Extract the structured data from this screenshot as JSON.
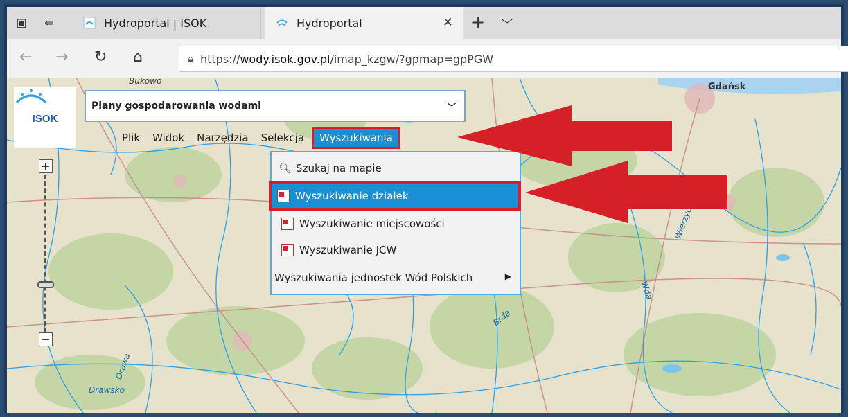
{
  "browser": {
    "tabs": [
      {
        "title": "Hydroportal | ISOK",
        "active": false
      },
      {
        "title": "Hydroportal",
        "active": true
      }
    ],
    "close_icon": "close-icon",
    "new_tab_icon": "plus-icon",
    "url_prefix": "https://",
    "url_host": "wody.isok.gov.pl",
    "url_path": "/imap_kzgw/?gpmap=gpPGW"
  },
  "app": {
    "logo_text": "ISOK",
    "plan_select_value": "Plany gospodarowania wodami",
    "menu": [
      "Plik",
      "Widok",
      "Narzędzia",
      "Selekcja",
      "Wyszukiwania"
    ],
    "active_menu": "Wyszukiwania",
    "dropdown": [
      {
        "label": "Szukaj na mapie",
        "icon": "search-icon"
      },
      {
        "label": "Wyszukiwanie działek",
        "icon": "layer-icon",
        "highlighted": true
      },
      {
        "label": "Wyszukiwanie miejscowości",
        "icon": "layer-icon"
      },
      {
        "label": "Wyszukiwanie JCW",
        "icon": "layer-icon"
      },
      {
        "label": "Wyszukiwania jednostek Wód Polskich",
        "icon": "submenu-arrow-icon"
      }
    ],
    "zoom_in": "+",
    "zoom_out": "−"
  },
  "map_labels": {
    "gdansk": "Gdańsk",
    "bukowo": "Bukowo",
    "drawa": "Drawa",
    "drawsko": "Drawsko",
    "brda": "Brda",
    "wda": "Wda",
    "wierzyca": "Wierzyca"
  },
  "colors": {
    "accent": "#1a8fd6",
    "annotation_red": "#d62028",
    "map_bg": "#e3dfc9",
    "river": "#2ea0e8"
  }
}
